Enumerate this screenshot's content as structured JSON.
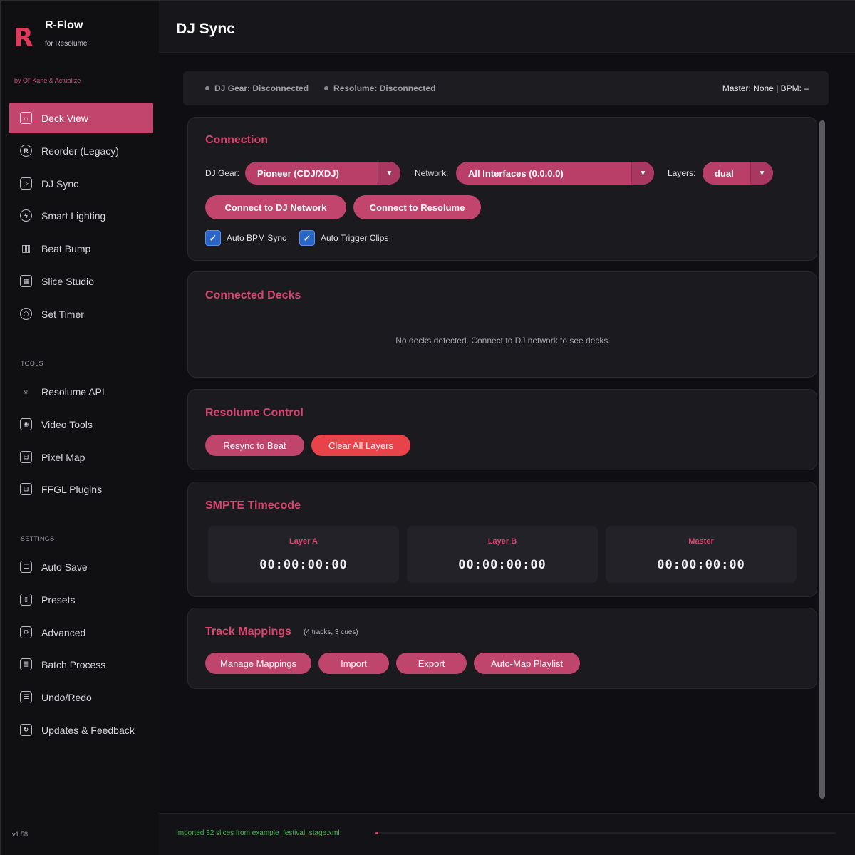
{
  "brand": {
    "logo": "R",
    "title": "R-Flow",
    "subtitle": "for Resolume",
    "by": "by Ol' Kane & Actualize"
  },
  "sidebar": {
    "items": [
      {
        "label": "Deck View",
        "icon": "home-icon",
        "active": true
      },
      {
        "label": "Reorder (Legacy)",
        "icon": "reorder-icon"
      },
      {
        "label": "DJ Sync",
        "icon": "play-icon"
      },
      {
        "label": "Smart Lighting",
        "icon": "lighting-icon"
      },
      {
        "label": "Beat Bump",
        "icon": "waveform-icon"
      },
      {
        "label": "Slice Studio",
        "icon": "image-icon"
      },
      {
        "label": "Set Timer",
        "icon": "clock-icon"
      }
    ],
    "tools_label": "TOOLS",
    "tools": [
      {
        "label": "Resolume API",
        "icon": "bulb-icon"
      },
      {
        "label": "Video Tools",
        "icon": "camera-icon"
      },
      {
        "label": "Pixel Map",
        "icon": "grid-icon"
      },
      {
        "label": "FFGL Plugins",
        "icon": "plugin-icon"
      }
    ],
    "settings_label": "SETTINGS",
    "settings": [
      {
        "label": "Auto Save",
        "icon": "list-icon"
      },
      {
        "label": "Presets",
        "icon": "preset-icon"
      },
      {
        "label": "Advanced",
        "icon": "gear-icon"
      },
      {
        "label": "Batch Process",
        "icon": "document-icon"
      },
      {
        "label": "Undo/Redo",
        "icon": "list-icon"
      },
      {
        "label": "Updates & Feedback",
        "icon": "refresh-icon"
      }
    ],
    "version": "v1.58"
  },
  "header": {
    "title": "DJ Sync"
  },
  "status": {
    "dj_gear": "DJ Gear: Disconnected",
    "resolume": "Resolume: Disconnected",
    "master": "Master: None | BPM: –"
  },
  "connection": {
    "title": "Connection",
    "dj_gear_label": "DJ Gear:",
    "dj_gear_value": "Pioneer (CDJ/XDJ)",
    "network_label": "Network:",
    "network_value": "All Interfaces (0.0.0.0)",
    "layers_label": "Layers:",
    "layers_value": "dual",
    "connect_dj": "Connect to DJ Network",
    "connect_resolume": "Connect to Resolume",
    "auto_bpm": "Auto BPM Sync",
    "auto_trigger": "Auto Trigger Clips"
  },
  "decks": {
    "title": "Connected Decks",
    "empty": "No decks detected. Connect to DJ network to see decks."
  },
  "resolume_control": {
    "title": "Resolume Control",
    "resync": "Resync to Beat",
    "clear": "Clear All Layers"
  },
  "smpte": {
    "title": "SMPTE Timecode",
    "boxes": [
      {
        "label": "Layer A",
        "value": "00:00:00:00"
      },
      {
        "label": "Layer B",
        "value": "00:00:00:00"
      },
      {
        "label": "Master",
        "value": "00:00:00:00"
      }
    ]
  },
  "mappings": {
    "title": "Track Mappings",
    "subtitle": "(4 tracks, 3 cues)",
    "manage": "Manage Mappings",
    "import": "Import",
    "export": "Export",
    "automap": "Auto-Map Playlist"
  },
  "footer": {
    "message": "Imported 32 slices from example_festival_stage.xml",
    "progress": 0.006
  },
  "colors": {
    "accent": "#c2456d",
    "title": "#d8466f",
    "danger": "#e9434a",
    "checkbox": "#2a66c8",
    "success": "#3db84a"
  }
}
